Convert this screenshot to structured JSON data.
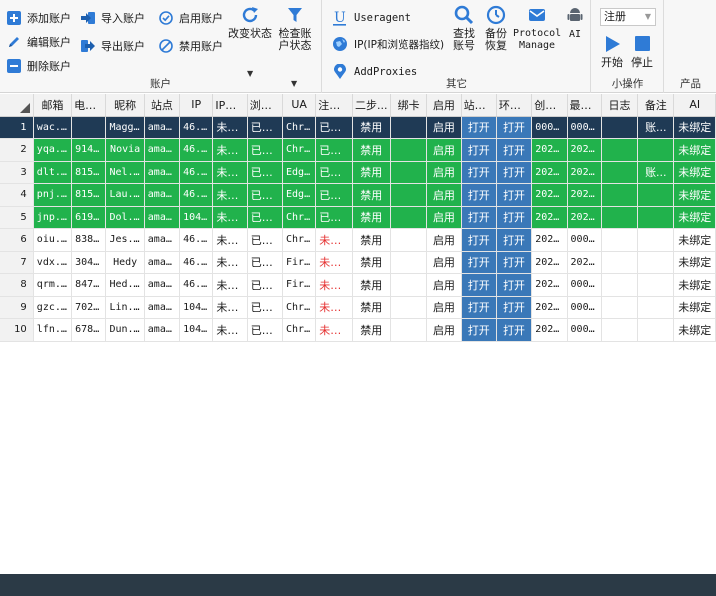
{
  "ribbon": {
    "account": {
      "add": "添加账户",
      "edit": "编辑账户",
      "delete": "删除账户",
      "import": "导入账户",
      "export": "导出账户",
      "enable": "启用账户",
      "disable": "禁用账户",
      "change_status": "改变状态",
      "check_status": "检查账户状态",
      "group_label": "账户"
    },
    "other": {
      "useragent": "Useragent",
      "ip_fp": "IP(IP和浏览器指纹)",
      "add_proxies": "AddProxies",
      "find_account": "查找账号",
      "backup_restore": "备份恢复",
      "protocol_manage": "Protocol Manage",
      "ai": "AI",
      "group_label": "其它"
    },
    "mini": {
      "select_value": "注册",
      "start": "开始",
      "stop": "停止",
      "group_label": "小操作"
    },
    "product": {
      "group_label": "产品"
    },
    "colors": {
      "blue": "#2f7bd6",
      "teal": "#1c7fb8",
      "red": "#d83a3a",
      "gray": "#5a6470"
    }
  },
  "grid": {
    "columns": [
      "邮箱",
      "电话...",
      "昵称",
      "站点",
      "IP",
      "IP指纹",
      "浏览...",
      "UA",
      "注册...",
      "二步...",
      "绑卡",
      "启用",
      "站点...",
      "环境...",
      "创建...",
      "最后...",
      "日志",
      "备注",
      "AI"
    ],
    "rows": [
      {
        "num": "1",
        "email": "wac...",
        "phone": "",
        "nick": "Maggie",
        "site": "ama...",
        "ip": "46...",
        "fp": "未绑定",
        "browser": "已绑定",
        "ua": "Chr...",
        "reg": "已注册",
        "twofa": "禁用",
        "card": "",
        "enabled": "启用",
        "site_open": "打开",
        "env_open": "打开",
        "created": "000...",
        "last": "000...",
        "log": "",
        "note": "账...",
        "ai": "未绑定"
      },
      {
        "num": "2",
        "email": "yqa...",
        "phone": "914...",
        "nick": "Novia",
        "site": "ama...",
        "ip": "46...",
        "fp": "未绑定",
        "browser": "已绑定",
        "ua": "Chr...",
        "reg": "已注册",
        "twofa": "禁用",
        "card": "",
        "enabled": "启用",
        "site_open": "打开",
        "env_open": "打开",
        "created": "202...",
        "last": "202...",
        "log": "",
        "note": "",
        "ai": "未绑定"
      },
      {
        "num": "3",
        "email": "dlt...",
        "phone": "815...",
        "nick": "Nel...",
        "site": "ama...",
        "ip": "46...",
        "fp": "未绑定",
        "browser": "已绑定",
        "ua": "Edg...",
        "reg": "已注册",
        "twofa": "禁用",
        "card": "",
        "enabled": "启用",
        "site_open": "打开",
        "env_open": "打开",
        "created": "202...",
        "last": "202...",
        "log": "",
        "note": "账...",
        "ai": "未绑定"
      },
      {
        "num": "4",
        "email": "pnj...",
        "phone": "815...",
        "nick": "Lau...",
        "site": "ama...",
        "ip": "46...",
        "fp": "未绑定",
        "browser": "已绑定",
        "ua": "Edg...",
        "reg": "已注册",
        "twofa": "禁用",
        "card": "",
        "enabled": "启用",
        "site_open": "打开",
        "env_open": "打开",
        "created": "202...",
        "last": "202...",
        "log": "",
        "note": "",
        "ai": "未绑定"
      },
      {
        "num": "5",
        "email": "jnp...",
        "phone": "619...",
        "nick": "Dol...",
        "site": "ama...",
        "ip": "104...",
        "fp": "未绑定",
        "browser": "已绑定",
        "ua": "Chr...",
        "reg": "已注册",
        "twofa": "禁用",
        "card": "",
        "enabled": "启用",
        "site_open": "打开",
        "env_open": "打开",
        "created": "202...",
        "last": "202...",
        "log": "",
        "note": "",
        "ai": "未绑定"
      },
      {
        "num": "6",
        "email": "oiu...",
        "phone": "838...",
        "nick": "Jes...",
        "site": "ama...",
        "ip": "46...",
        "fp": "未绑定",
        "browser": "已绑定",
        "ua": "Chr...",
        "reg": "未注册",
        "twofa": "禁用",
        "card": "",
        "enabled": "启用",
        "site_open": "打开",
        "env_open": "打开",
        "created": "202...",
        "last": "000...",
        "log": "",
        "note": "",
        "ai": "未绑定"
      },
      {
        "num": "7",
        "email": "vdx...",
        "phone": "304...",
        "nick": "Hedy",
        "site": "ama...",
        "ip": "46...",
        "fp": "未绑定",
        "browser": "已绑定",
        "ua": "Fir...",
        "reg": "未注册",
        "twofa": "禁用",
        "card": "",
        "enabled": "启用",
        "site_open": "打开",
        "env_open": "打开",
        "created": "202...",
        "last": "202...",
        "log": "",
        "note": "",
        "ai": "未绑定"
      },
      {
        "num": "8",
        "email": "qrm...",
        "phone": "847...",
        "nick": "Hed...",
        "site": "ama...",
        "ip": "46...",
        "fp": "未绑定",
        "browser": "已绑定",
        "ua": "Fir...",
        "reg": "未注册",
        "twofa": "禁用",
        "card": "",
        "enabled": "启用",
        "site_open": "打开",
        "env_open": "打开",
        "created": "202...",
        "last": "000...",
        "log": "",
        "note": "",
        "ai": "未绑定"
      },
      {
        "num": "9",
        "email": "gzc...",
        "phone": "702...",
        "nick": "Lin...",
        "site": "ama...",
        "ip": "104...",
        "fp": "未绑定",
        "browser": "已绑定",
        "ua": "Chr...",
        "reg": "未注册",
        "twofa": "禁用",
        "card": "",
        "enabled": "启用",
        "site_open": "打开",
        "env_open": "打开",
        "created": "202...",
        "last": "000...",
        "log": "",
        "note": "",
        "ai": "未绑定"
      },
      {
        "num": "10",
        "email": "lfn...",
        "phone": "678...",
        "nick": "Dun...",
        "site": "ama...",
        "ip": "104...",
        "fp": "未绑定",
        "browser": "已绑定",
        "ua": "Chr...",
        "reg": "未注册",
        "twofa": "禁用",
        "card": "",
        "enabled": "启用",
        "site_open": "打开",
        "env_open": "打开",
        "created": "202...",
        "last": "000...",
        "log": "",
        "note": "",
        "ai": "未绑定"
      }
    ],
    "green_rows": 5
  }
}
